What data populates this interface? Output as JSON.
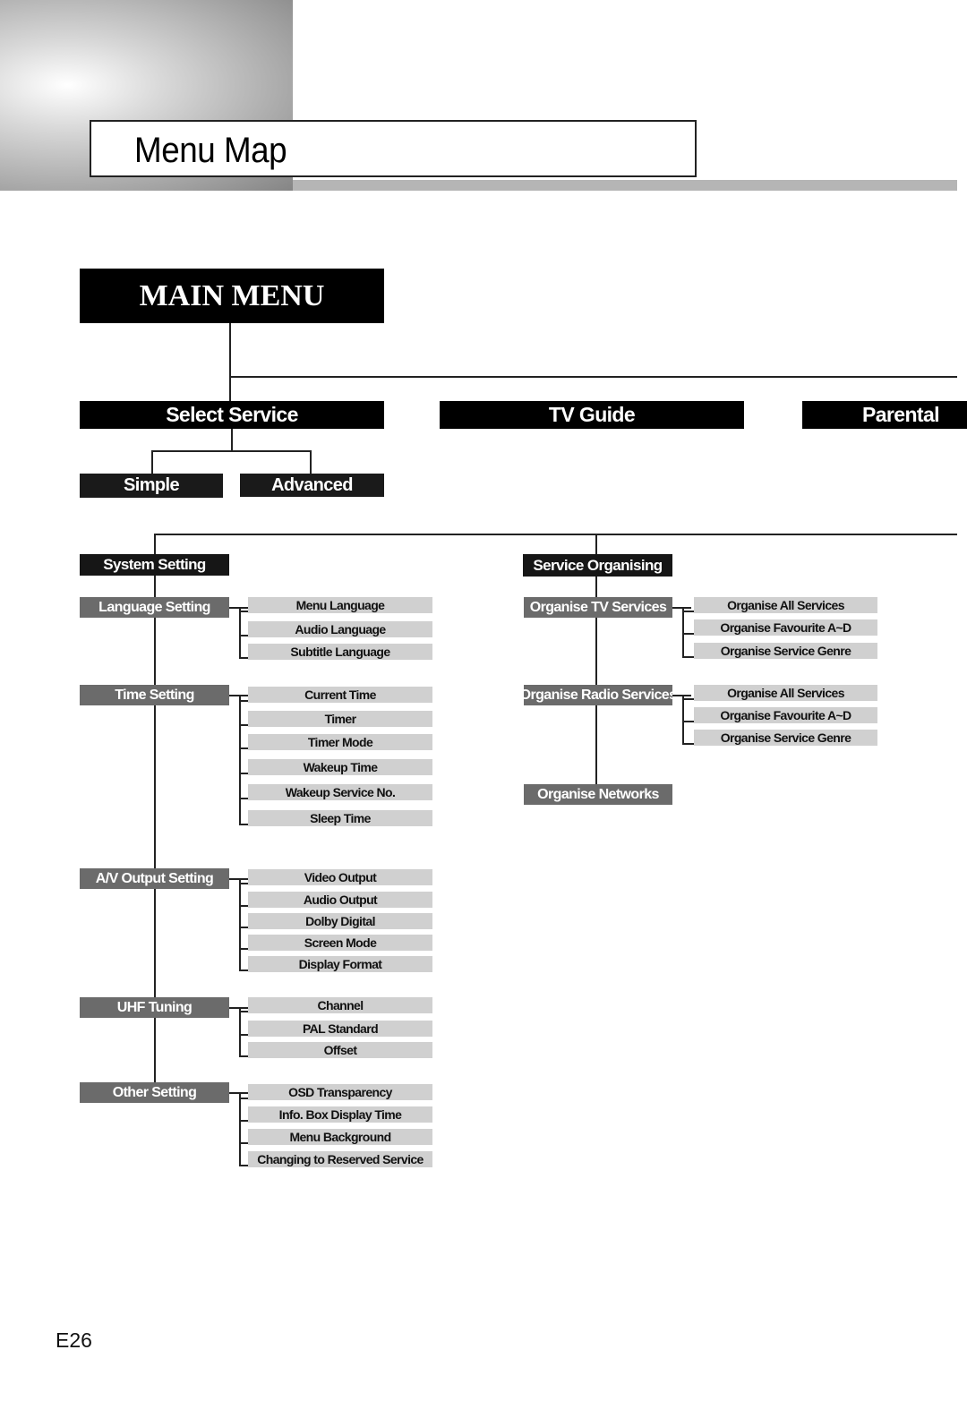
{
  "page": {
    "title": "Menu Map",
    "page_number": "E26"
  },
  "main_menu": {
    "label": "MAIN  MENU",
    "top_items": [
      {
        "label": "Select Service",
        "children": [
          "Simple",
          "Advanced"
        ]
      },
      {
        "label": "TV Guide"
      },
      {
        "label": "Parental"
      }
    ]
  },
  "system_setting": {
    "label": "System Setting",
    "groups": [
      {
        "label": "Language Setting",
        "items": [
          "Menu Language",
          "Audio Language",
          "Subtitle Language"
        ]
      },
      {
        "label": "Time Setting",
        "items": [
          "Current Time",
          "Timer",
          "Timer Mode",
          "Wakeup Time",
          "Wakeup Service No.",
          "Sleep Time"
        ]
      },
      {
        "label": "A/V Output Setting",
        "items": [
          "Video  Output",
          "Audio Output",
          "Dolby Digital",
          "Screen Mode",
          "Display Format"
        ]
      },
      {
        "label": "UHF Tuning",
        "items": [
          "Channel",
          "PAL Standard",
          "Offset"
        ]
      },
      {
        "label": "Other Setting",
        "items": [
          "OSD Transparency",
          "Info. Box Display Time",
          "Menu Background",
          "Changing to Reserved Service"
        ]
      }
    ]
  },
  "service_organising": {
    "label": "Service Organising",
    "groups": [
      {
        "label": "Organise TV Services",
        "items": [
          "Organise All Services",
          "Organise Favourite A~D",
          "Organise  Service Genre"
        ]
      },
      {
        "label": "Organise Radio Services",
        "items": [
          "Organise All Services",
          "Organise Favourite A~D",
          "Organise  Service Genre"
        ]
      },
      {
        "label": "Organise Networks",
        "items": []
      }
    ]
  }
}
